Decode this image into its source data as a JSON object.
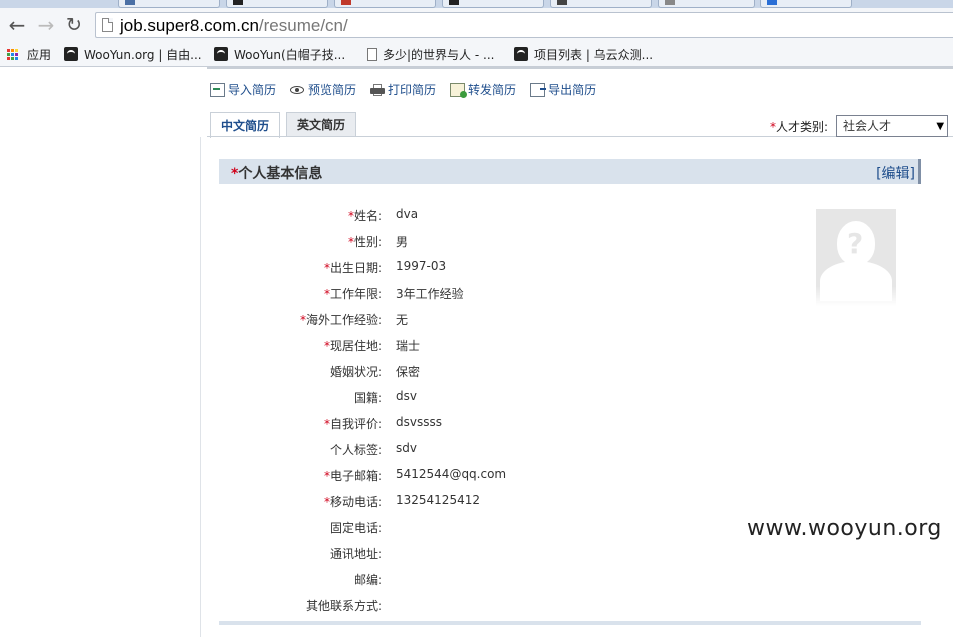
{
  "browser": {
    "url_host": "job.super8.com.cn",
    "url_path": "/resume/cn/",
    "bookmarks": [
      {
        "label": "应用",
        "icon": "apps-grid-icon"
      },
      {
        "label": "WooYun.org | 自由...",
        "icon": "wooyun-icon"
      },
      {
        "label": "WooYun(白帽子技...",
        "icon": "wooyun-icon"
      },
      {
        "label": "多少|的世界与人 - ...",
        "icon": "document-icon"
      },
      {
        "label": "项目列表 | 乌云众测...",
        "icon": "wooyun-icon"
      }
    ]
  },
  "actions": [
    {
      "label": "导入简历",
      "icon": "import-icon"
    },
    {
      "label": "预览简历",
      "icon": "eye-icon"
    },
    {
      "label": "打印简历",
      "icon": "printer-icon"
    },
    {
      "label": "转发简历",
      "icon": "forward-icon"
    },
    {
      "label": "导出简历",
      "icon": "export-icon"
    }
  ],
  "tabs": [
    {
      "label": "中文简历",
      "active": true
    },
    {
      "label": "英文简历",
      "active": false
    }
  ],
  "category": {
    "required_mark": "*",
    "label": "人才类别:",
    "selected": "社会人才"
  },
  "section": {
    "required_mark": "*",
    "title": "个人基本信息",
    "edit_label": "[编辑]"
  },
  "fields": [
    {
      "required": true,
      "label": "姓名:",
      "value": "dva"
    },
    {
      "required": true,
      "label": "性别:",
      "value": "男"
    },
    {
      "required": true,
      "label": "出生日期:",
      "value": "1997-03"
    },
    {
      "required": true,
      "label": "工作年限:",
      "value": "3年工作经验"
    },
    {
      "required": true,
      "label": "海外工作经验:",
      "value": "无"
    },
    {
      "required": true,
      "label": "现居住地:",
      "value": "瑞士"
    },
    {
      "required": false,
      "label": "婚姻状况:",
      "value": "保密"
    },
    {
      "required": false,
      "label": "国籍:",
      "value": "dsv"
    },
    {
      "required": true,
      "label": "自我评价:",
      "value": "dsvssss"
    },
    {
      "required": false,
      "label": "个人标签:",
      "value": "sdv"
    },
    {
      "required": true,
      "label": "电子邮箱:",
      "value": "5412544@qq.com"
    },
    {
      "required": true,
      "label": "移动电话:",
      "value": "13254125412"
    },
    {
      "required": false,
      "label": "固定电话:",
      "value": ""
    },
    {
      "required": false,
      "label": "通讯地址:",
      "value": ""
    },
    {
      "required": false,
      "label": "邮编:",
      "value": ""
    },
    {
      "required": false,
      "label": "其他联系方式:",
      "value": ""
    }
  ],
  "watermark": "www.wooyun.org",
  "colors": {
    "link": "#1f4e8c",
    "required": "#d0021b",
    "section_bg": "#d9e2ec"
  }
}
